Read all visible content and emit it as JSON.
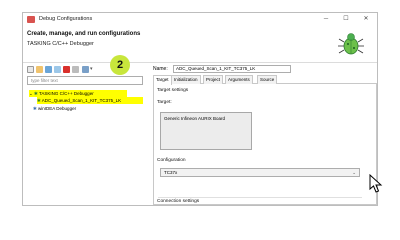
{
  "window": {
    "title": "Debug Configurations",
    "minimize": "─",
    "maximize": "☐",
    "close": "✕"
  },
  "header": {
    "title": "Create, manage, and run configurations",
    "subtitle": "TASKING C/C++ Debugger"
  },
  "left": {
    "filter_placeholder": "type filter text",
    "tree": [
      {
        "label": "TASKING C/C++ Debugger",
        "expanded": true
      },
      {
        "label": "ADC_Queued_Scan_1_KIT_TC375_LK"
      },
      {
        "label": "winIDEA Debugger"
      }
    ]
  },
  "badge": "2",
  "right": {
    "name_label": "Name:",
    "name_value": "ADC_Queued_Scan_1_KIT_TC375_LK",
    "tabs": [
      {
        "label": "Target",
        "active": true
      },
      {
        "label": "Initialization"
      },
      {
        "label": "Project"
      },
      {
        "label": "Arguments"
      },
      {
        "label": "Source"
      }
    ],
    "target_settings": "Target settings",
    "target_label": "Target:",
    "target_item": "Generic Infineon AURIX Board",
    "configuration_label": "Configuration",
    "configuration_value": "TC37x",
    "connection_settings": "Connection settings"
  },
  "colors": {
    "highlight": "#ffff00",
    "badge": "#c8e63c"
  }
}
